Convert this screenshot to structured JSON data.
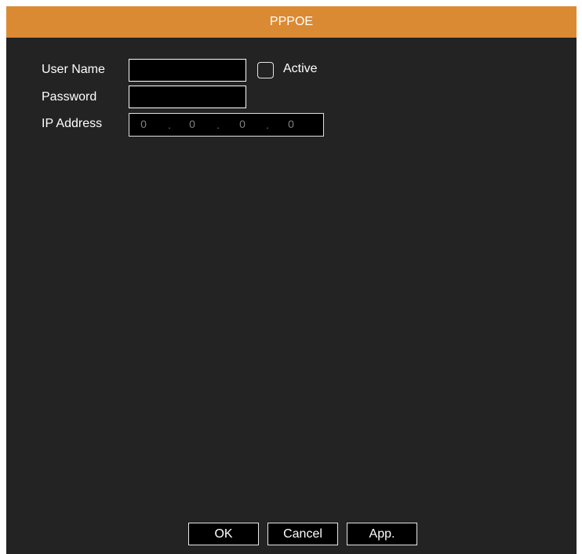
{
  "dialog": {
    "title": "PPPOE",
    "colors": {
      "titlebar": "#db8a34",
      "background": "#232323",
      "field": "#000000",
      "text": "#ffffff",
      "muted_text": "#808080"
    }
  },
  "form": {
    "user_name_label": "User Name",
    "user_name_value": "",
    "active_label": "Active",
    "active_checked": false,
    "password_label": "Password",
    "password_value": "",
    "ip_address_label": "IP Address",
    "ip_octets": [
      "0",
      "0",
      "0",
      "0"
    ],
    "ip_separator": "."
  },
  "buttons": {
    "ok": "OK",
    "cancel": "Cancel",
    "apply": "App."
  }
}
